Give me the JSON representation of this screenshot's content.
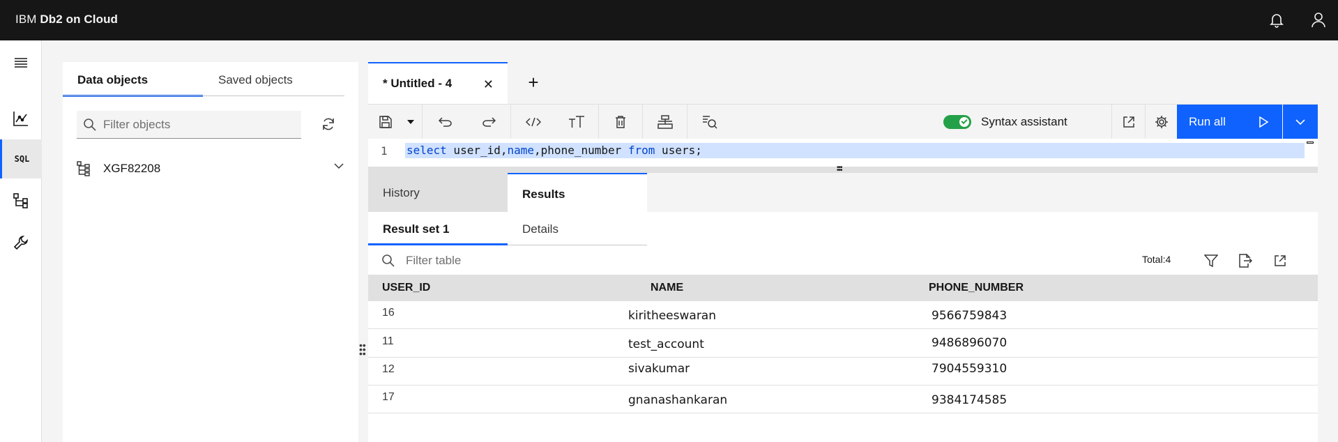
{
  "header": {
    "brand_prefix": "IBM",
    "brand_product": "Db2 on Cloud",
    "notification_icon": "bell-icon",
    "user_icon": "user-icon"
  },
  "rail": {
    "items": [
      {
        "icon": "menu-icon"
      },
      {
        "icon": "chart-icon"
      },
      {
        "icon": "sql-icon",
        "label": "SQL",
        "active": true
      },
      {
        "icon": "schema-tree-icon"
      },
      {
        "icon": "wrench-icon"
      }
    ]
  },
  "objects_panel": {
    "tabs": [
      {
        "label": "Data objects",
        "active": true
      },
      {
        "label": "Saved objects",
        "active": false
      }
    ],
    "filter_placeholder": "Filter objects",
    "schema_name": "XGF82208"
  },
  "editor": {
    "file_tab": {
      "name": "* Untitled - 4",
      "close": "✕"
    },
    "add_tab": "+",
    "syntax_assistant": {
      "label": "Syntax assistant",
      "enabled": true
    },
    "run_all_label": "Run all",
    "code": {
      "line_number": "1",
      "tokens": [
        {
          "text": "select",
          "kw": true
        },
        {
          "text": " user_id,",
          "kw": false
        },
        {
          "text": "name",
          "kw": true
        },
        {
          "text": ",phone_number ",
          "kw": false
        },
        {
          "text": "from",
          "kw": true
        },
        {
          "text": " users;",
          "kw": false
        }
      ]
    }
  },
  "results_panel": {
    "tabs": [
      {
        "label": "History",
        "active": false
      },
      {
        "label": "Results",
        "active": true
      }
    ],
    "sub_tabs": [
      {
        "label": "Result set 1",
        "active": true
      },
      {
        "label": "Details",
        "active": false
      }
    ],
    "filter_placeholder": "Filter table",
    "total": "Total:4",
    "columns": [
      "USER_ID",
      "NAME",
      "PHONE_NUMBER"
    ],
    "rows": [
      [
        "16",
        "kiritheeswaran",
        "9566759843"
      ],
      [
        "11",
        "test_account",
        "9486896070"
      ],
      [
        "12",
        "sivakumar",
        "7904559310"
      ],
      [
        "17",
        "gnanashankaran",
        "9384174585"
      ]
    ]
  },
  "colors": {
    "accent": "#0f62fe",
    "header_bg": "#161616",
    "toggle_on": "#24a148",
    "selection": "#d0e2ff"
  }
}
